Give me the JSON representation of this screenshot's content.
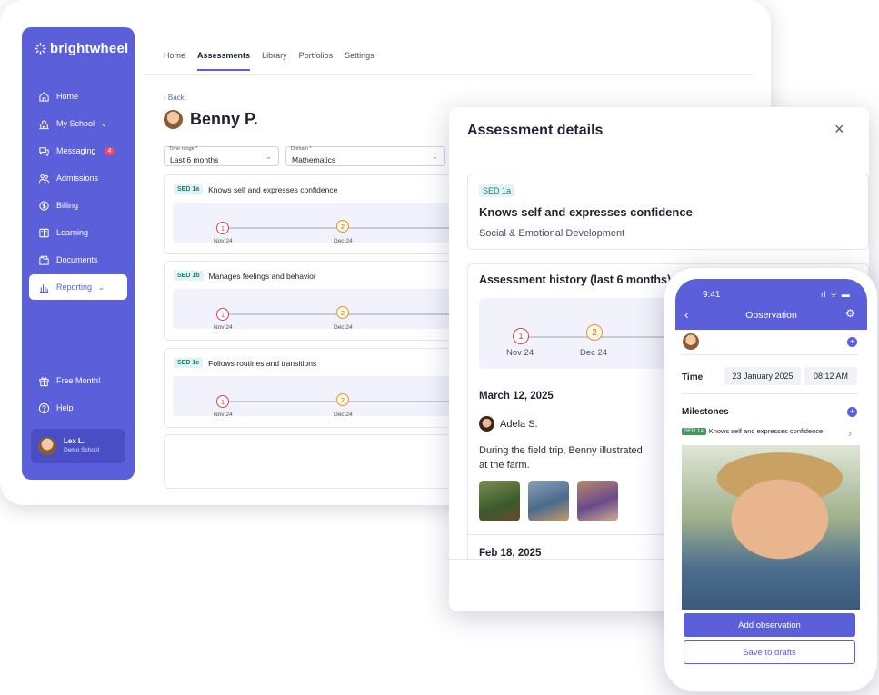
{
  "app": {
    "brand": "brightwheel",
    "nav": [
      {
        "label": "Home",
        "icon": "home-icon"
      },
      {
        "label": "My School",
        "icon": "school-icon",
        "chevron": true
      },
      {
        "label": "Messaging",
        "icon": "messaging-icon",
        "badge": "4"
      },
      {
        "label": "Admissions",
        "icon": "admissions-icon"
      },
      {
        "label": "Billing",
        "icon": "billing-icon"
      },
      {
        "label": "Learning",
        "icon": "learning-icon"
      },
      {
        "label": "Documents",
        "icon": "documents-icon"
      },
      {
        "label": "Reporting",
        "icon": "reporting-icon",
        "chevron": true,
        "active": true
      }
    ],
    "free_month": "Free Month!",
    "help": "Help",
    "user": {
      "name": "Lex L.",
      "school": "Demo School"
    },
    "tabs": [
      "Home",
      "Assessments",
      "Library",
      "Portfolios",
      "Settings"
    ],
    "active_tab": "Assessments",
    "back": "‹ Back",
    "student": "Benny P.",
    "filters": {
      "time_range": {
        "label": "Time range *",
        "value": "Last 6 months"
      },
      "domain": {
        "label": "Domain *",
        "value": "Mathematics"
      }
    },
    "cards": [
      {
        "tag": "SED 1a",
        "title": "Knows self and expresses confidence",
        "points": [
          {
            "value": "1",
            "label": "Nov 24",
            "color": "#d9434e"
          },
          {
            "value": "2",
            "label": "Dec 24",
            "color": "#d99a2a"
          }
        ]
      },
      {
        "tag": "SED 1b",
        "title": "Manages feelings and behavior",
        "points": [
          {
            "value": "1",
            "label": "Nov 24",
            "color": "#d9434e"
          },
          {
            "value": "2",
            "label": "Dec 24",
            "color": "#d99a2a"
          }
        ]
      },
      {
        "tag": "SED 1c",
        "title": "Follows routines and transitions",
        "points": [
          {
            "value": "1",
            "label": "Nov 24",
            "color": "#d9434e"
          },
          {
            "value": "2",
            "label": "Dec 24",
            "color": "#d99a2a"
          }
        ]
      }
    ],
    "accent": "#5b5fd9"
  },
  "details": {
    "title": "Assessment details",
    "tag": "SED 1a",
    "skill": "Knows self and expresses confidence",
    "domain": "Social & Emotional Development",
    "history_title": "Assessment history (last 6 months)",
    "history_points": [
      {
        "value": "1",
        "label": "Nov 24"
      },
      {
        "value": "2",
        "label": "Dec 24"
      }
    ],
    "entry_date": "March 12, 2025",
    "entry_author": "Adela S.",
    "entry_text_1": "During the field trip, Benny illustrated",
    "entry_text_2": "at the farm.",
    "next_date": "Feb 18, 2025"
  },
  "phone": {
    "time": "9:41",
    "title": "Observation",
    "time_label": "Time",
    "date": "23 January 2025",
    "clock": "08:12 AM",
    "milestones_label": "Milestones",
    "milestone_tag": "SED 1a",
    "milestone_text": "Knows self and expresses confidence",
    "add_button": "Add observation",
    "drafts_button": "Save to drafts"
  }
}
